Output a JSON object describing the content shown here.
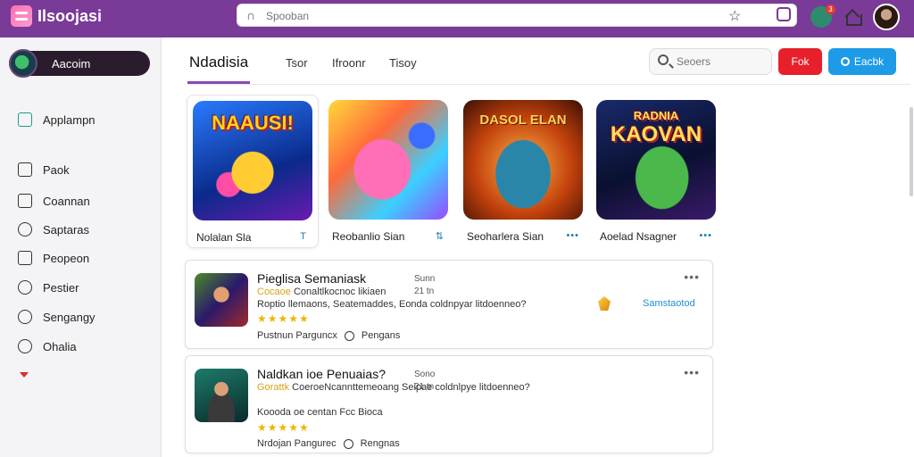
{
  "app": {
    "name": "Ilsoojasi"
  },
  "topbar": {
    "search_placeholder": "Spooban",
    "notification_count": "3"
  },
  "sidebar": {
    "user": "Aacoim",
    "items": [
      {
        "label": "Applampn",
        "icon": "store-icon"
      },
      {
        "label": "Paok",
        "icon": "bag-icon"
      },
      {
        "label": "Coannan",
        "icon": "list-icon"
      },
      {
        "label": "Saptaras",
        "icon": "settings-icon"
      },
      {
        "label": "Peopeon",
        "icon": "square-icon"
      },
      {
        "label": "Pestier",
        "icon": "pen-icon"
      },
      {
        "label": "Sengangy",
        "icon": "group-icon"
      },
      {
        "label": "Ohalia",
        "icon": "chat-icon"
      }
    ]
  },
  "main": {
    "title": "Ndadisia",
    "tabs": [
      "Tsor",
      "Ifroonr",
      "Tisoy"
    ],
    "search_placeholder": "Seoers",
    "btn_red": "Fok",
    "btn_blue": "Eacbk"
  },
  "cards": [
    {
      "art_title": "NAAUSI!",
      "label": "Nolalan Sla",
      "action": "T"
    },
    {
      "art_title": "",
      "label": "Reobanlio Sian",
      "action": "⇅"
    },
    {
      "art_title": "DASOL ELAN",
      "label": "Seoharlera Sian",
      "action": "•••"
    },
    {
      "art_title_top": "RADNIA",
      "art_title": "KAOVAN",
      "label": "Aoelad Nsagner",
      "action": "•••"
    }
  ],
  "list": [
    {
      "title": "Pieglisa Semaniask",
      "meta1": "Sunn",
      "meta2": "21 tn",
      "line1_hl": "Cocaoe",
      "line1": "Conaltlkocnoc likiaen",
      "line2": "Roptio llemaons, Seatemaddes, Eonda coldnpyar litdoenneo?",
      "rating": "★★★★★",
      "rating_after": " ",
      "foot1": "Pustnun Parguncx",
      "foot2": "Pengans",
      "link": "Samstaotod"
    },
    {
      "title": "Naldkan ioe Penuaias?",
      "meta1": "Sono",
      "meta2": "21 tn",
      "line1_hl": "Gorattk",
      "line1": "CoeroeNcannttemeoang Seipae coldnlpye litdoenneo?",
      "line2_hl": "Koooda",
      "line2": "oe centan Fcc Bioca",
      "rating": "★★★★★",
      "foot1": "Nrdojan Pangurec",
      "foot2": "Rengnas"
    }
  ]
}
